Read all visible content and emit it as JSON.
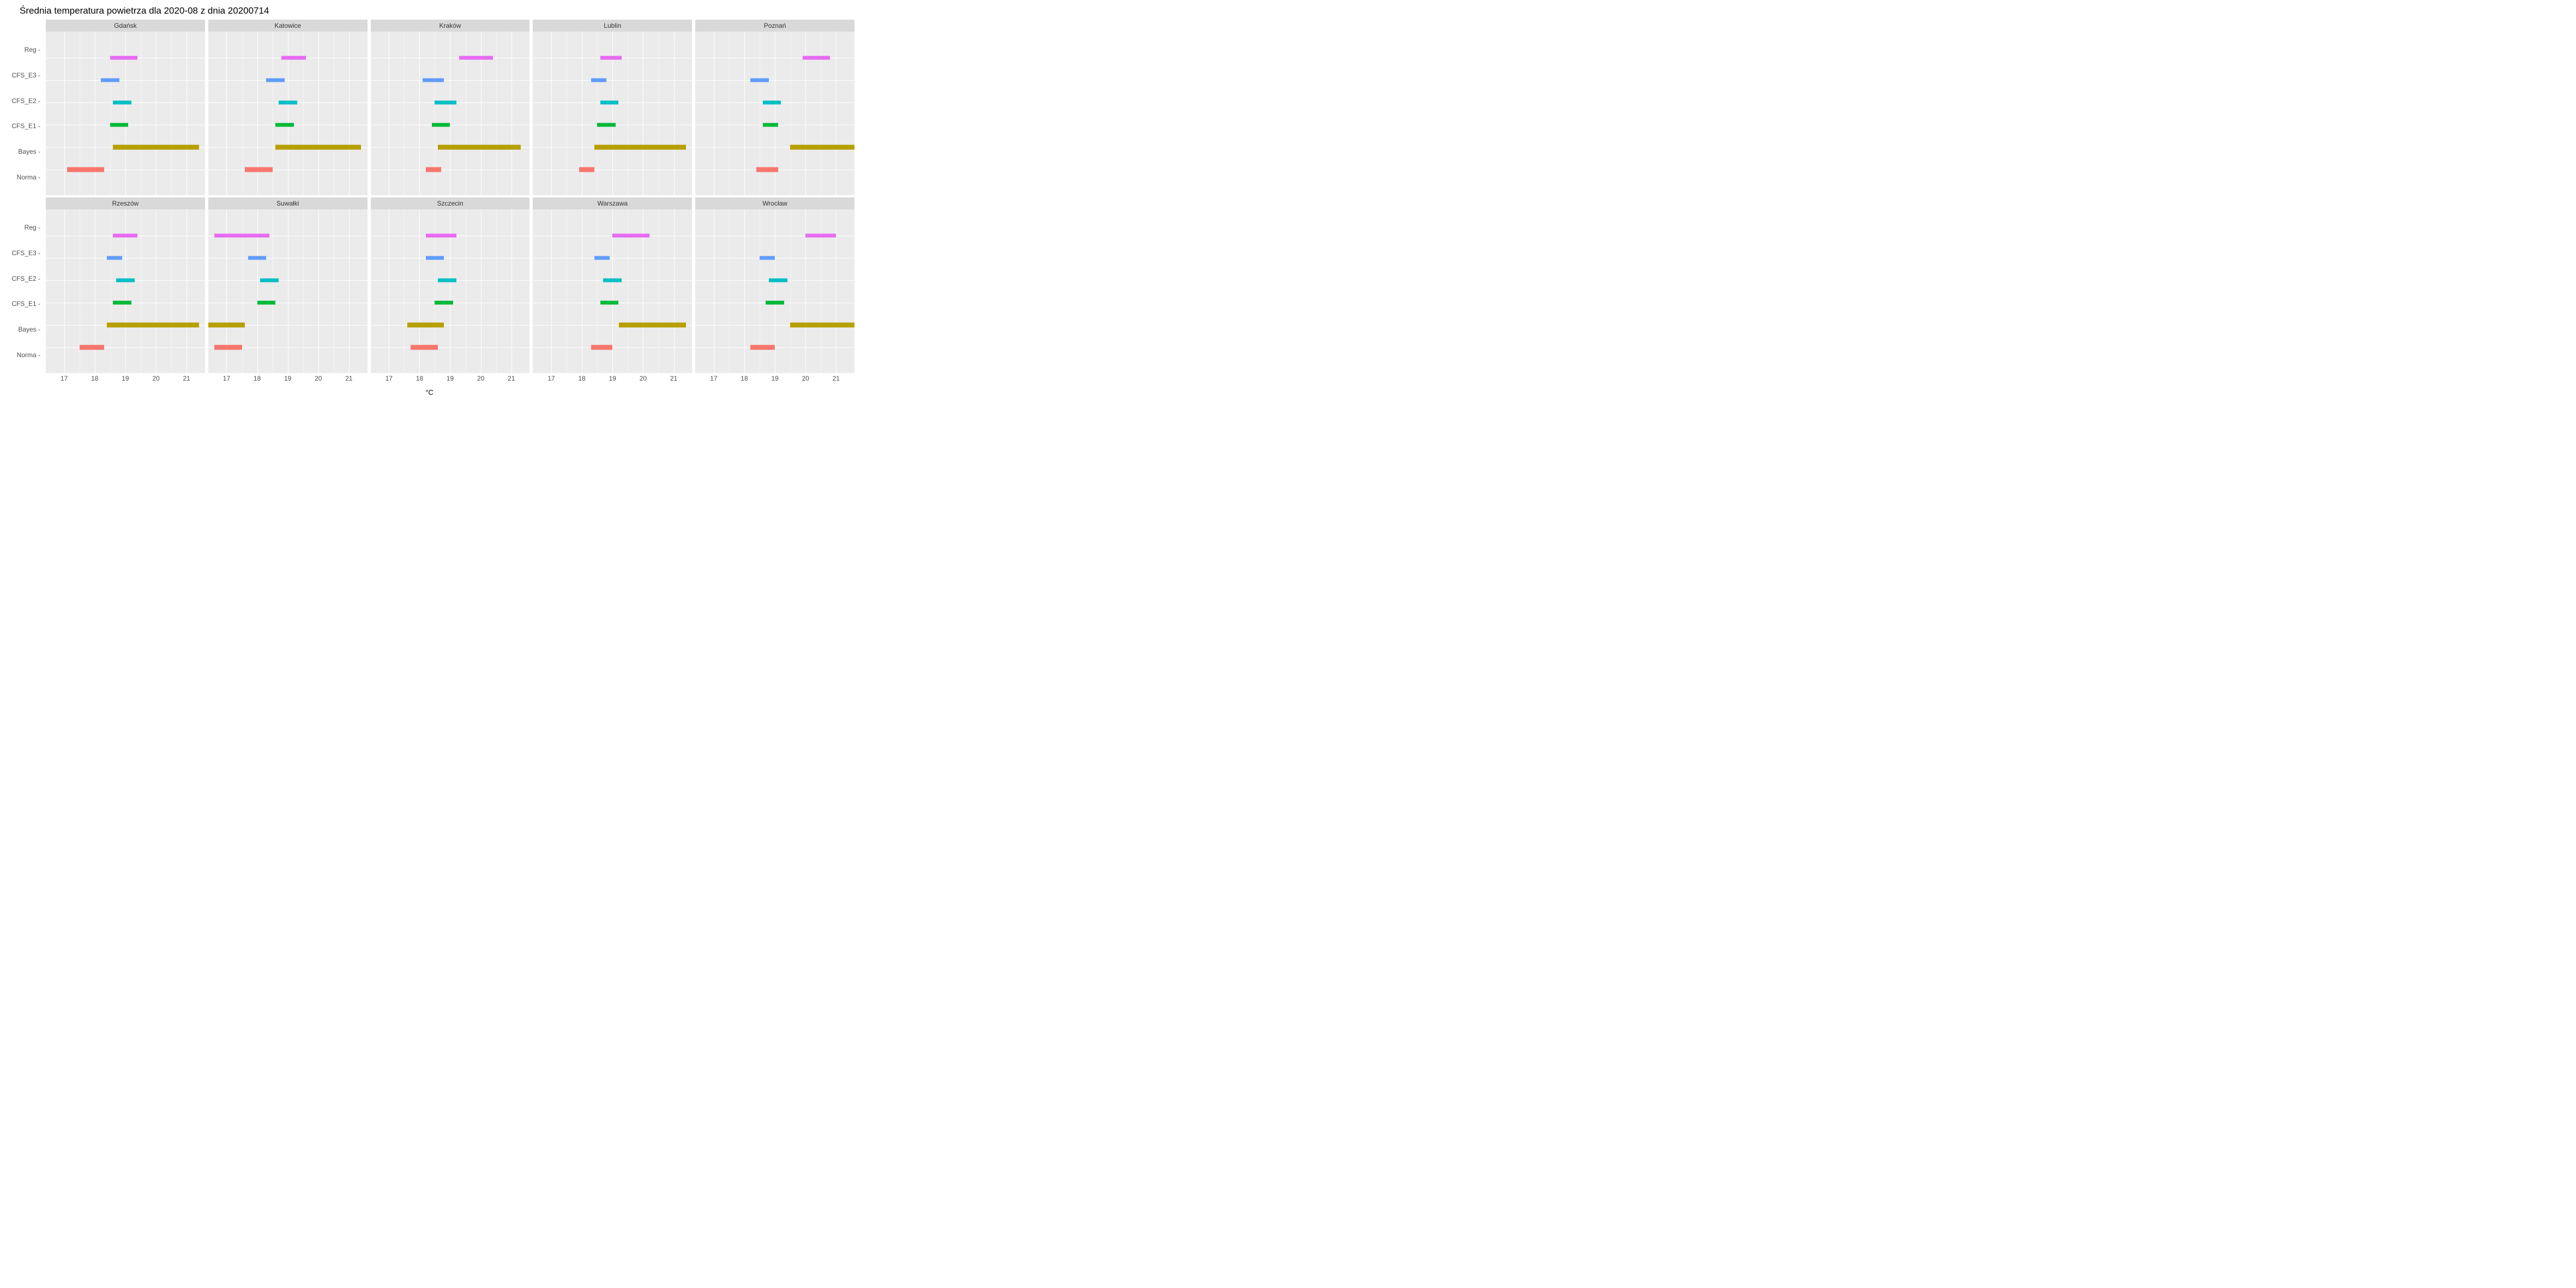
{
  "title": "Średnia temperatura powietrza dla 2020-08 z dnia 20200714",
  "xlabel": "°C",
  "x_domain": [
    16.4,
    21.6
  ],
  "x_ticks": [
    17,
    18,
    19,
    20,
    21
  ],
  "y_categories": [
    "Reg",
    "CFS_E3",
    "CFS_E2",
    "CFS_E1",
    "Bayes",
    "Norma"
  ],
  "colors": {
    "Reg": "#e76bf3",
    "CFS_E3": "#619cff",
    "CFS_E2": "#00bfc4",
    "CFS_E1": "#00ba38",
    "Bayes": "#b79f00",
    "Norma": "#f8766d"
  },
  "bar_height": {
    "Reg": "thin",
    "CFS_E3": "thin",
    "CFS_E2": "thin",
    "CFS_E1": "thin",
    "Bayes": "thick",
    "Norma": "thick"
  },
  "chart_data": [
    {
      "city": "Gdańsk",
      "series": {
        "Reg": [
          18.5,
          19.4
        ],
        "CFS_E3": [
          18.2,
          18.8
        ],
        "CFS_E2": [
          18.6,
          19.2
        ],
        "CFS_E1": [
          18.5,
          19.1
        ],
        "Bayes": [
          18.6,
          21.4
        ],
        "Norma": [
          17.1,
          18.3
        ]
      }
    },
    {
      "city": "Katowice",
      "series": {
        "Reg": [
          18.8,
          19.6
        ],
        "CFS_E3": [
          18.3,
          18.9
        ],
        "CFS_E2": [
          18.7,
          19.3
        ],
        "CFS_E1": [
          18.6,
          19.2
        ],
        "Bayes": [
          18.6,
          21.4
        ],
        "Norma": [
          17.6,
          18.5
        ]
      }
    },
    {
      "city": "Kraków",
      "series": {
        "Reg": [
          19.3,
          20.4
        ],
        "CFS_E3": [
          18.1,
          18.8
        ],
        "CFS_E2": [
          18.5,
          19.2
        ],
        "CFS_E1": [
          18.4,
          19.0
        ],
        "Bayes": [
          18.6,
          21.3
        ],
        "Norma": [
          18.2,
          18.7
        ]
      }
    },
    {
      "city": "Lublin",
      "series": {
        "Reg": [
          18.6,
          19.3
        ],
        "CFS_E3": [
          18.3,
          18.8
        ],
        "CFS_E2": [
          18.6,
          19.2
        ],
        "CFS_E1": [
          18.5,
          19.1
        ],
        "Bayes": [
          18.4,
          21.4
        ],
        "Norma": [
          17.9,
          18.4
        ]
      }
    },
    {
      "city": "Poznań",
      "series": {
        "Reg": [
          19.9,
          20.8
        ],
        "CFS_E3": [
          18.2,
          18.8
        ],
        "CFS_E2": [
          18.6,
          19.2
        ],
        "CFS_E1": [
          18.6,
          19.1
        ],
        "Bayes": [
          19.5,
          21.6
        ],
        "Norma": [
          18.4,
          19.1
        ]
      }
    },
    {
      "city": "Rzeszów",
      "series": {
        "Reg": [
          18.6,
          19.4
        ],
        "CFS_E3": [
          18.4,
          18.9
        ],
        "CFS_E2": [
          18.7,
          19.3
        ],
        "CFS_E1": [
          18.6,
          19.2
        ],
        "Bayes": [
          18.4,
          21.4
        ],
        "Norma": [
          17.5,
          18.3
        ]
      }
    },
    {
      "city": "Suwałki",
      "series": {
        "Reg": [
          16.6,
          18.4
        ],
        "CFS_E3": [
          17.7,
          18.3
        ],
        "CFS_E2": [
          18.1,
          18.7
        ],
        "CFS_E1": [
          18.0,
          18.6
        ],
        "Bayes": [
          16.4,
          17.6
        ],
        "Norma": [
          16.6,
          17.5
        ]
      }
    },
    {
      "city": "Szczecin",
      "series": {
        "Reg": [
          18.2,
          19.2
        ],
        "CFS_E3": [
          18.2,
          18.8
        ],
        "CFS_E2": [
          18.6,
          19.2
        ],
        "CFS_E1": [
          18.5,
          19.1
        ],
        "Bayes": [
          17.6,
          18.8
        ],
        "Norma": [
          17.7,
          18.6
        ]
      }
    },
    {
      "city": "Warszawa",
      "series": {
        "Reg": [
          19.0,
          20.2
        ],
        "CFS_E3": [
          18.4,
          18.9
        ],
        "CFS_E2": [
          18.7,
          19.3
        ],
        "CFS_E1": [
          18.6,
          19.2
        ],
        "Bayes": [
          19.2,
          21.4
        ],
        "Norma": [
          18.3,
          19.0
        ]
      }
    },
    {
      "city": "Wrocław",
      "series": {
        "Reg": [
          20.0,
          21.0
        ],
        "CFS_E3": [
          18.5,
          19.0
        ],
        "CFS_E2": [
          18.8,
          19.4
        ],
        "CFS_E1": [
          18.7,
          19.3
        ],
        "Bayes": [
          19.5,
          21.6
        ],
        "Norma": [
          18.2,
          19.0
        ]
      }
    }
  ]
}
